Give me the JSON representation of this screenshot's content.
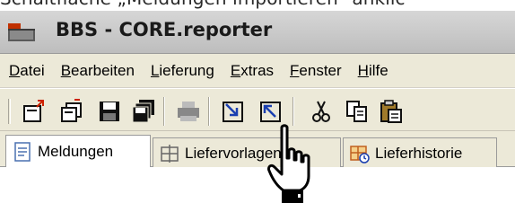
{
  "caption": "Schaltfläche „Meldungen importieren“ anklic",
  "window": {
    "title": "BBS - CORE.reporter",
    "app_icon": "folder-icon"
  },
  "menu": [
    {
      "label": "Datei",
      "accel": "D",
      "rest": "atei"
    },
    {
      "label": "Bearbeiten",
      "accel": "B",
      "rest": "earbeiten"
    },
    {
      "label": "Lieferung",
      "accel": "L",
      "rest": "ieferung"
    },
    {
      "label": "Extras",
      "accel": "E",
      "rest": "xtras"
    },
    {
      "label": "Fenster",
      "accel": "F",
      "rest": "enster"
    },
    {
      "label": "Hilfe",
      "accel": "H",
      "rest": "ilfe"
    }
  ],
  "toolbar": {
    "buttons": [
      "new-report-icon",
      "open-report-icon",
      "save-icon",
      "save-all-icon",
      "print-icon",
      "import-messages-icon",
      "export-messages-icon",
      "cut-icon",
      "copy-icon",
      "paste-icon"
    ]
  },
  "tabs": [
    {
      "label": "Meldungen",
      "icon": "document-icon",
      "active": true
    },
    {
      "label": "Liefervorlagen",
      "icon": "grid-icon",
      "active": false
    },
    {
      "label": "Lieferhistorie",
      "icon": "history-icon",
      "active": false
    }
  ],
  "cursor": "hand-pointer-icon",
  "colors": {
    "chrome": "#ece9d8",
    "titlebar": "#c9c9c9",
    "accent_red": "#cc2200",
    "accent_blue": "#1a3fb0"
  }
}
